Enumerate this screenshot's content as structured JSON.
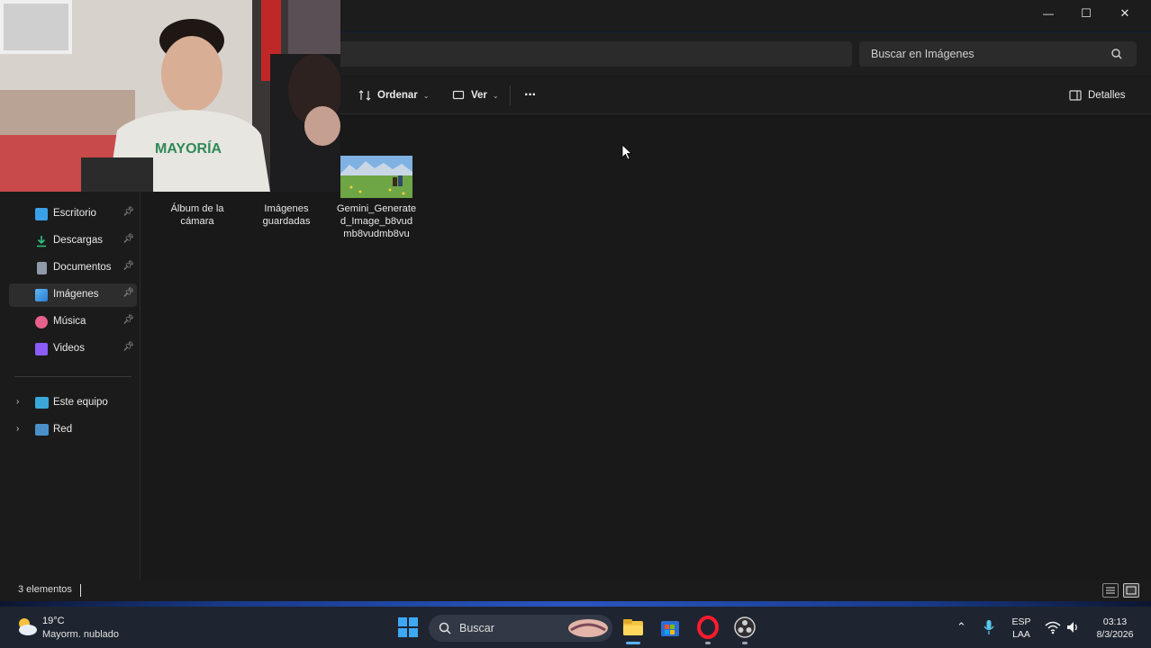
{
  "window": {
    "search_placeholder": "Buscar en Imágenes",
    "controls": {
      "minimize": "—",
      "maximize": "☐",
      "close": "✕"
    }
  },
  "toolbar": {
    "sort_label": "Ordenar",
    "view_label": "Ver",
    "more_label": "···",
    "details_label": "Detalles"
  },
  "sidebar": {
    "quick_access": [
      {
        "label": "Escritorio",
        "icon": "desktop-icon",
        "pinned": true
      },
      {
        "label": "Descargas",
        "icon": "download-icon",
        "pinned": true
      },
      {
        "label": "Documentos",
        "icon": "document-icon",
        "pinned": true
      },
      {
        "label": "Imágenes",
        "icon": "pictures-icon",
        "pinned": true,
        "active": true
      },
      {
        "label": "Música",
        "icon": "music-icon",
        "pinned": true
      },
      {
        "label": "Videos",
        "icon": "video-icon",
        "pinned": true
      }
    ],
    "tree": [
      {
        "label": "Este equipo",
        "icon": "computer-icon"
      },
      {
        "label": "Red",
        "icon": "network-icon"
      }
    ]
  },
  "files": [
    {
      "name_lines": [
        "Álbum de la",
        "cámara"
      ],
      "type": "folder"
    },
    {
      "name_lines": [
        "Imágenes",
        "guardadas"
      ],
      "type": "folder"
    },
    {
      "name_lines": [
        "Gemini_Generate",
        "d_Image_b8vud",
        "mb8vudmb8vu"
      ],
      "type": "image"
    }
  ],
  "status": {
    "item_count": "3 elementos"
  },
  "taskbar": {
    "weather_temp": "19°C",
    "weather_desc": "Mayorm. nublado",
    "search_label": "Buscar",
    "lang_top": "ESP",
    "lang_bottom": "LAA",
    "time": "03:13",
    "date": "8/3/2026"
  },
  "colors": {
    "accent": "#4cc2ff",
    "window_bg": "#191919",
    "taskbar_bg": "#1f2530"
  }
}
